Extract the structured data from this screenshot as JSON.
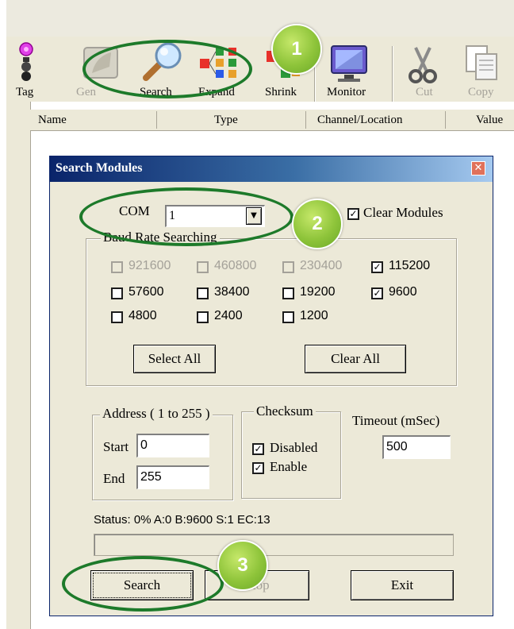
{
  "toolbar": {
    "items": [
      {
        "label": "Tag",
        "icon": "tag-icon",
        "enabled": true
      },
      {
        "label": "Gen",
        "icon": "generate-icon",
        "enabled": false
      },
      {
        "label": "Search",
        "icon": "magnifier-icon",
        "enabled": true
      },
      {
        "label": "Expand",
        "icon": "expand-icon",
        "enabled": true
      },
      {
        "label": "Shrink",
        "icon": "shrink-icon",
        "enabled": true
      },
      {
        "label": "Monitor",
        "icon": "monitor-icon",
        "enabled": true
      },
      {
        "label": "Cut",
        "icon": "scissors-icon",
        "enabled": false
      },
      {
        "label": "Copy",
        "icon": "copy-icon",
        "enabled": false
      }
    ]
  },
  "list_header": {
    "columns": [
      "Name",
      "Type",
      "Channel/Location",
      "Value"
    ]
  },
  "dialog": {
    "title": "Search Modules",
    "com_label": "COM",
    "com_value": "1",
    "clear_modules_label": "Clear Modules",
    "clear_modules_checked": true,
    "baud_group_label": "Baud Rate Searching",
    "baud_rates": [
      {
        "label": "921600",
        "checked": false,
        "enabled": false
      },
      {
        "label": "460800",
        "checked": false,
        "enabled": false
      },
      {
        "label": "230400",
        "checked": false,
        "enabled": false
      },
      {
        "label": "115200",
        "checked": true,
        "enabled": true
      },
      {
        "label": "57600",
        "checked": false,
        "enabled": true
      },
      {
        "label": "38400",
        "checked": false,
        "enabled": true
      },
      {
        "label": "19200",
        "checked": false,
        "enabled": true
      },
      {
        "label": "9600",
        "checked": true,
        "enabled": true
      },
      {
        "label": "4800",
        "checked": false,
        "enabled": true
      },
      {
        "label": "2400",
        "checked": false,
        "enabled": true
      },
      {
        "label": "1200",
        "checked": false,
        "enabled": true
      }
    ],
    "select_all_label": "Select All",
    "clear_all_label": "Clear All",
    "address_group_label": "Address ( 1 to 255 )",
    "start_label": "Start",
    "start_value": "0",
    "end_label": "End",
    "end_value": "255",
    "checksum_group_label": "Checksum",
    "checksum_disabled_label": "Disabled",
    "checksum_enabled_label": "Enable",
    "checksum_disabled_checked": true,
    "checksum_enabled_checked": true,
    "timeout_label": "Timeout (mSec)",
    "timeout_value": "500",
    "status_text": "Status:  0% A:0 B:9600 S:1 EC:13",
    "progress_fraction": 0,
    "search_button": "Search",
    "stop_button": "Stop",
    "exit_button": "Exit"
  },
  "callouts": [
    "1",
    "2",
    "3"
  ],
  "colors": {
    "callout_green": "#8ec43a",
    "ellipse_green": "#1d7a2a",
    "title_bar": "#0a246a",
    "dialog_bg": "#ece9d8"
  }
}
